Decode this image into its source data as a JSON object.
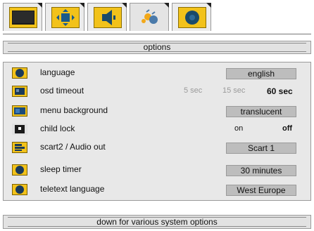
{
  "tabs": [
    {
      "icon": "monitor-icon"
    },
    {
      "icon": "arrows-icon"
    },
    {
      "icon": "speaker-icon"
    },
    {
      "icon": "satellite-icon"
    },
    {
      "icon": "options-icon"
    }
  ],
  "title": "options",
  "rows": [
    {
      "label": "language",
      "icon": "language-icon",
      "value": "english"
    },
    {
      "label": "osd timeout",
      "icon": "osd-timeout-icon",
      "options": [
        "5 sec",
        "15 sec",
        "60 sec"
      ],
      "selected": "60 sec"
    },
    {
      "label": "menu background",
      "icon": "menu-background-icon",
      "value": "translucent"
    },
    {
      "label": "child lock",
      "icon": "child-lock-icon",
      "options": [
        "on",
        "off"
      ],
      "selected": "off"
    },
    {
      "label": "scart2 / Audio out",
      "icon": "scart-icon",
      "value": "Scart 1"
    },
    {
      "label": "sleep timer",
      "icon": "sleep-timer-icon",
      "value": "30  minutes"
    },
    {
      "label": "teletext language",
      "icon": "teletext-icon",
      "value": "West Europe"
    }
  ],
  "footer": "down for various system options",
  "colors": {
    "icon_bg": "#f2c21a",
    "panel_bg": "#e8e8e8",
    "value_box": "#bdbdbd"
  }
}
